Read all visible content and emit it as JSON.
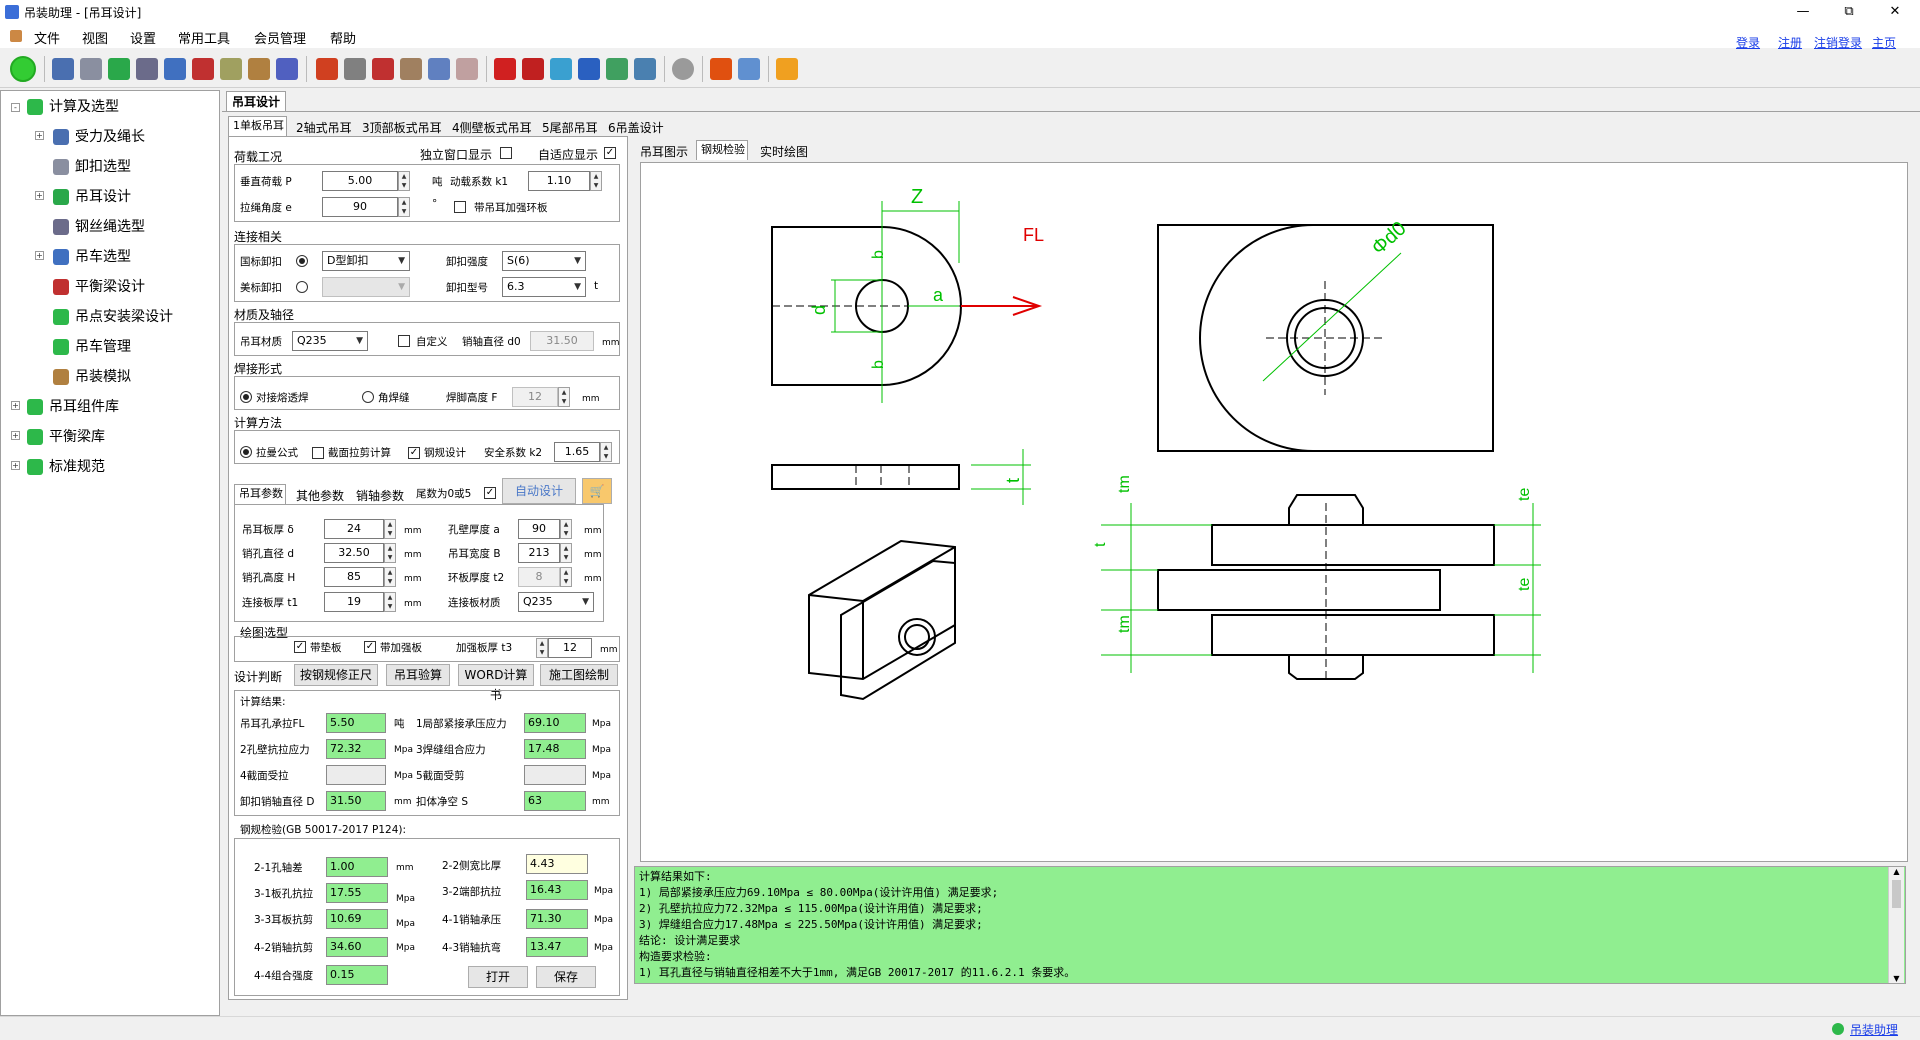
{
  "title": "吊装助理 - [吊耳设计]",
  "menu": [
    "文件",
    "视图",
    "设置",
    "常用工具",
    "会员管理",
    "帮助"
  ],
  "toplinks": [
    "登录",
    "注册",
    "注销登录",
    "主页"
  ],
  "tree": {
    "items": [
      {
        "label": "计算及选型"
      },
      {
        "label": "受力及绳长"
      },
      {
        "label": "卸扣选型"
      },
      {
        "label": "吊耳设计"
      },
      {
        "label": "钢丝绳选型"
      },
      {
        "label": "吊车选型"
      },
      {
        "label": "平衡梁设计"
      },
      {
        "label": "吊点安装梁设计"
      },
      {
        "label": "吊车管理"
      },
      {
        "label": "吊装模拟"
      },
      {
        "label": "吊耳组件库"
      },
      {
        "label": "平衡梁库"
      },
      {
        "label": "标准规范"
      }
    ]
  },
  "doc_tab": "吊耳设计",
  "subtabs": [
    "1单板吊耳",
    "2轴式吊耳",
    "3顶部板式吊耳",
    "4侧壁板式吊耳",
    "5尾部吊耳",
    "6吊盖设计"
  ],
  "right_tabs": [
    "吊耳图示",
    "钢规检验",
    "实时绘图"
  ],
  "load": {
    "group": "荷载工况",
    "independent": "独立窗口显示",
    "adaptive": "自适应显示",
    "vload_label": "垂直荷载 P",
    "vload": "5.00",
    "vload_unit": "吨",
    "dyn_label": "动载系数 k1",
    "dyn": "1.10",
    "angle_label": "拉绳角度 e",
    "angle": "90",
    "angle_unit": "°",
    "ring_label": "带吊耳加强环板"
  },
  "conn": {
    "group": "连接相关",
    "gb_label": "国标卸扣",
    "gb_value": "D型卸扣",
    "strength_label": "卸扣强度",
    "strength": "S(6)",
    "us_label": "美标卸扣",
    "model_label": "卸扣型号",
    "model": "6.3",
    "model_unit": "t"
  },
  "mat": {
    "group": "材质及轴径",
    "mat_label": "吊耳材质",
    "mat": "Q235",
    "custom_label": "自定义",
    "pin_label": "销轴直径 d0",
    "pin": "31.50",
    "pin_unit": "mm"
  },
  "weld": {
    "group": "焊接形式",
    "butt": "对接熔透焊",
    "fillet": "角焊缝",
    "height_label": "焊脚高度 F",
    "height": "12",
    "height_unit": "mm"
  },
  "calc": {
    "group": "计算方法",
    "formula": "拉曼公式",
    "section": "截面拉剪计算",
    "steel": "钢规设计",
    "safety_label": "安全系数 k2",
    "safety": "1.65"
  },
  "params": {
    "tabs": [
      "吊耳参数",
      "其他参数",
      "销轴参数"
    ],
    "tail_label": "尾数为0或5",
    "auto_btn": "自动设计",
    "fields": [
      {
        "label": "吊耳板厚 δ",
        "value": "24",
        "unit": "mm"
      },
      {
        "label": "孔壁厚度 a",
        "value": "90",
        "unit": "mm"
      },
      {
        "label": "销孔直径 d",
        "value": "32.50",
        "unit": "mm"
      },
      {
        "label": "吊耳宽度 B",
        "value": "213",
        "unit": "mm"
      },
      {
        "label": "销孔高度 H",
        "value": "85",
        "unit": "mm"
      },
      {
        "label": "环板厚度 t2",
        "value": "8",
        "unit": "mm"
      },
      {
        "label": "连接板厚 t1",
        "value": "19",
        "unit": "mm"
      },
      {
        "label": "连接板材质",
        "value": "Q235",
        "unit": ""
      }
    ]
  },
  "drawing": {
    "group": "绘图选型",
    "pad": "带垫板",
    "rib": "带加强板",
    "rib_label": "加强板厚 t3",
    "rib_value": "12",
    "rib_unit": "mm"
  },
  "design": {
    "label": "设计判断",
    "buttons": [
      "按钢规修正尺",
      "吊耳验算",
      "WORD计算书",
      "施工图绘制"
    ]
  },
  "results": {
    "title": "计算结果:",
    "rows": [
      {
        "label": "吊耳孔承拉FL",
        "value": "5.50",
        "unit": "吨"
      },
      {
        "label": "1局部紧接承压应力",
        "value": "69.10",
        "unit": "Mpa"
      },
      {
        "label": "2孔壁抗拉应力",
        "value": "72.32",
        "unit": "Mpa"
      },
      {
        "label": "3焊缝组合应力",
        "value": "17.48",
        "unit": "Mpa"
      },
      {
        "label": "4截面受拉",
        "value": "",
        "unit": "Mpa"
      },
      {
        "label": "5截面受剪",
        "value": "",
        "unit": "Mpa"
      },
      {
        "label": "卸扣销轴直径 D",
        "value": "31.50",
        "unit": "mm"
      },
      {
        "label": "扣体净空 S",
        "value": "63",
        "unit": "mm"
      }
    ]
  },
  "steelcheck": {
    "title": "钢规检验(GB 50017-2017 P124):",
    "rows": [
      {
        "label": "2-1孔轴差",
        "value": "1.00",
        "unit": "mm"
      },
      {
        "label": "2-2侧宽比厚",
        "value": "4.43",
        "unit": ""
      },
      {
        "label": "3-1板孔抗拉",
        "value": "17.55",
        "unit": "Mpa"
      },
      {
        "label": "3-2端部抗拉",
        "value": "16.43",
        "unit": "Mpa"
      },
      {
        "label": "3-3耳板抗剪",
        "value": "10.69",
        "unit": "Mpa"
      },
      {
        "label": "4-1销轴承压",
        "value": "71.30",
        "unit": "Mpa"
      },
      {
        "label": "4-2销轴抗剪",
        "value": "34.60",
        "unit": "Mpa"
      },
      {
        "label": "4-3销轴抗弯",
        "value": "13.47",
        "unit": "Mpa"
      },
      {
        "label": "4-4组合强度",
        "value": "0.15",
        "unit": ""
      }
    ],
    "open_btn": "打开",
    "save_btn": "保存"
  },
  "dims": {
    "Z": "Z",
    "b1": "b",
    "b2": "b",
    "a": "a",
    "d": "d",
    "FL": "FL",
    "d0": "Φd0",
    "t": "t",
    "tm1": "tm",
    "tm2": "tm",
    "t2": "t",
    "te1": "te",
    "te2": "te"
  },
  "resultlog": [
    "计算结果如下:",
    "    1) 局部紧接承压应力69.10Mpa ≤ 80.00Mpa(设计许用值)  满足要求;",
    "    2) 孔壁抗拉应力72.32Mpa ≤ 115.00Mpa(设计许用值)  满足要求;",
    "    3) 焊缝组合应力17.48Mpa ≤ 225.50Mpa(设计许用值)  满足要求;",
    "    结论: 设计满足要求",
    "构造要求检验:",
    "    1) 耳孔直径与销轴直径相差不大于1mm, 满足GB 20017-2017 的11.6.2.1 条要求。"
  ],
  "status": "吊装助理",
  "colors": {
    "result_green": "#90ee90",
    "link_blue": "#1a3ee8",
    "dim_green": "#00c000",
    "force_red": "#e00000"
  }
}
